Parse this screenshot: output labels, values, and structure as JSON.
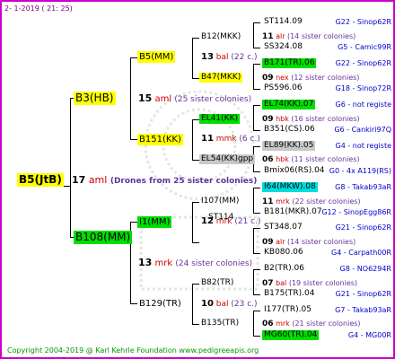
{
  "header": "2-  1-2019 ( 21: 25)",
  "footer": "Copyright 2004-2019 @ Karl Kehrle Foundation    www.pedigreeapis.org",
  "root": {
    "name": "B5(JtB)",
    "gen_num": "17",
    "gen_label": "aml",
    "drones": "(Drones from 25 sister colonies)"
  },
  "level1": [
    {
      "name": "B3(HB)",
      "num": "15",
      "label": "aml",
      "sisters": "(25 sister colonies)"
    },
    {
      "name": "B108(MM)",
      "num": "13",
      "label": "mrk",
      "sisters": "(24 sister colonies)"
    }
  ],
  "level2": [
    {
      "name": "B5(MM)",
      "num": "13",
      "label": "bal",
      "sisters": "(22 c.)"
    },
    {
      "name": "B151(KK)",
      "num": "11",
      "label": "mmk",
      "sisters": "(6 c.)"
    },
    {
      "name": "I1(MM)",
      "num": "12",
      "label": "mrk",
      "sisters": "(21 c.)"
    },
    {
      "name": "B129(TR)",
      "num": "10",
      "label": "bal",
      "sisters": "(23 c.)"
    }
  ],
  "level3": [
    {
      "name": "B12(MKK)",
      "num": "11",
      "label": "alr",
      "sisters": "(14 sister colonies)"
    },
    {
      "name": "B47(MKK)",
      "num": "09",
      "label": "nex",
      "sisters": "(12 sister colonies)"
    },
    {
      "name": "EL41(KK)",
      "num": "09",
      "label": "hbk",
      "sisters": "(16 sister colonies)"
    },
    {
      "name": "EL54(KK)gpp",
      "num": "06",
      "label": "hbk",
      "sisters": "(11 sister colonies)"
    },
    {
      "name": "I107(MM)",
      "num": "11",
      "label": "mrk",
      "sisters": "(22 sister colonies)"
    },
    {
      "name": "ST114",
      "num": "09",
      "label": "alr",
      "sisters": "(14 sister colonies)"
    },
    {
      "name": "B82(TR)",
      "num": "07",
      "label": "bal",
      "sisters": "(19 sister colonies)"
    },
    {
      "name": "B135(TR)",
      "num": "06",
      "label": "mrk",
      "sisters": "(21 sister colonies)"
    }
  ],
  "level4": [
    {
      "name": "ST114.09",
      "source": "G22 - Sinop62R"
    },
    {
      "name": "SS324.08",
      "source": "G5 - Camic99R"
    },
    {
      "name": "B171(TR).06",
      "source": "G22 - Sinop62R"
    },
    {
      "name": "PS596.06",
      "source": "G18 - Sinop72R"
    },
    {
      "name": "EL74(KK).07",
      "source": "G6 - not registe"
    },
    {
      "name": "B351(CS).06",
      "source": "G6 - Cankiri97Q"
    },
    {
      "name": "EL89(KK).05",
      "source": "G4 - not registe"
    },
    {
      "name": "Bmix06(RS).04",
      "source": "G0 - 4x A119(RS)"
    },
    {
      "name": "I64(MKW).08",
      "source": "G8 - Takab93aR"
    },
    {
      "name": "B181(MKR).07",
      "source": "G12 - SinopEgg86R"
    },
    {
      "name": "ST348.07",
      "source": "G21 - Sinop62R"
    },
    {
      "name": "KB080.06",
      "source": "G4 - Carpath00R"
    },
    {
      "name": "B2(TR).06",
      "source": "G8 - NO6294R"
    },
    {
      "name": "B175(TR).04",
      "source": "G21 - Sinop62R"
    },
    {
      "name": "I177(TR).05",
      "source": "G7 - Takab93aR"
    },
    {
      "name": "MG60(TR).04",
      "source": "G4 - MG00R"
    }
  ],
  "colors": {
    "border": "#cc00cc",
    "highlight_yellow": "#ffff00",
    "highlight_green": "#00dd00",
    "highlight_gray": "#c8c8c8",
    "highlight_cyan": "#00dddd",
    "label_red": "#cc0000",
    "sister_purple": "#663399",
    "source_blue": "#0000cc",
    "footer_green": "#009900"
  }
}
